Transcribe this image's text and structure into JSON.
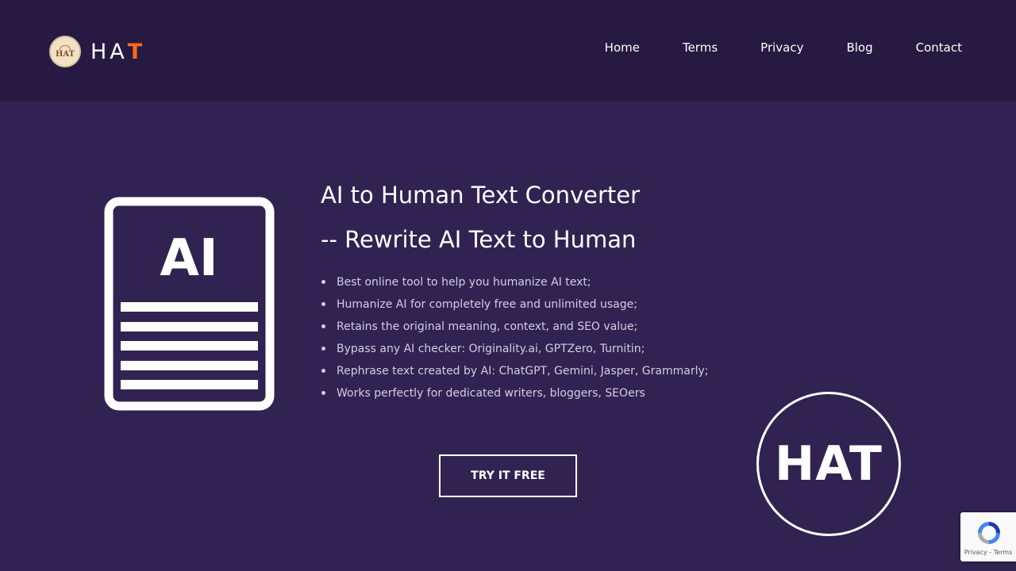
{
  "brand": {
    "badge_text": "HAT",
    "name_main": "HA",
    "name_accent": "T",
    "accent_color": "#ff6a1c"
  },
  "nav": {
    "items": [
      {
        "label": "Home"
      },
      {
        "label": "Terms"
      },
      {
        "label": "Privacy"
      },
      {
        "label": "Blog"
      },
      {
        "label": "Contact"
      }
    ]
  },
  "hero": {
    "icon_text": "AI",
    "title_line1": "AI to Human Text Converter",
    "title_line2": "-- Rewrite AI Text to Human",
    "features": [
      "Best online tool to help you humanize AI text;",
      "Humanize AI for completely free and unlimited usage;",
      "Retains the original meaning, context, and SEO value;",
      "Bypass any AI checker: Originality.ai, GPTZero, Turnitin;",
      "Rephrase text created by AI: ChatGPT, Gemini, Jasper, Grammarly;",
      "Works perfectly for dedicated writers, bloggers, SEOers"
    ],
    "cta_label": "TRY IT FREE",
    "badge_text": "HAT"
  },
  "recaptcha": {
    "privacy": "Privacy",
    "separator": " - ",
    "terms": "Terms"
  },
  "colors": {
    "page_bg": "#302352",
    "header_bg": "#261a42",
    "text": "#ffffff",
    "muted_text": "#d4cde3"
  },
  "icons": [
    "hat-logo-icon",
    "ai-document-icon",
    "recaptcha-icon"
  ]
}
